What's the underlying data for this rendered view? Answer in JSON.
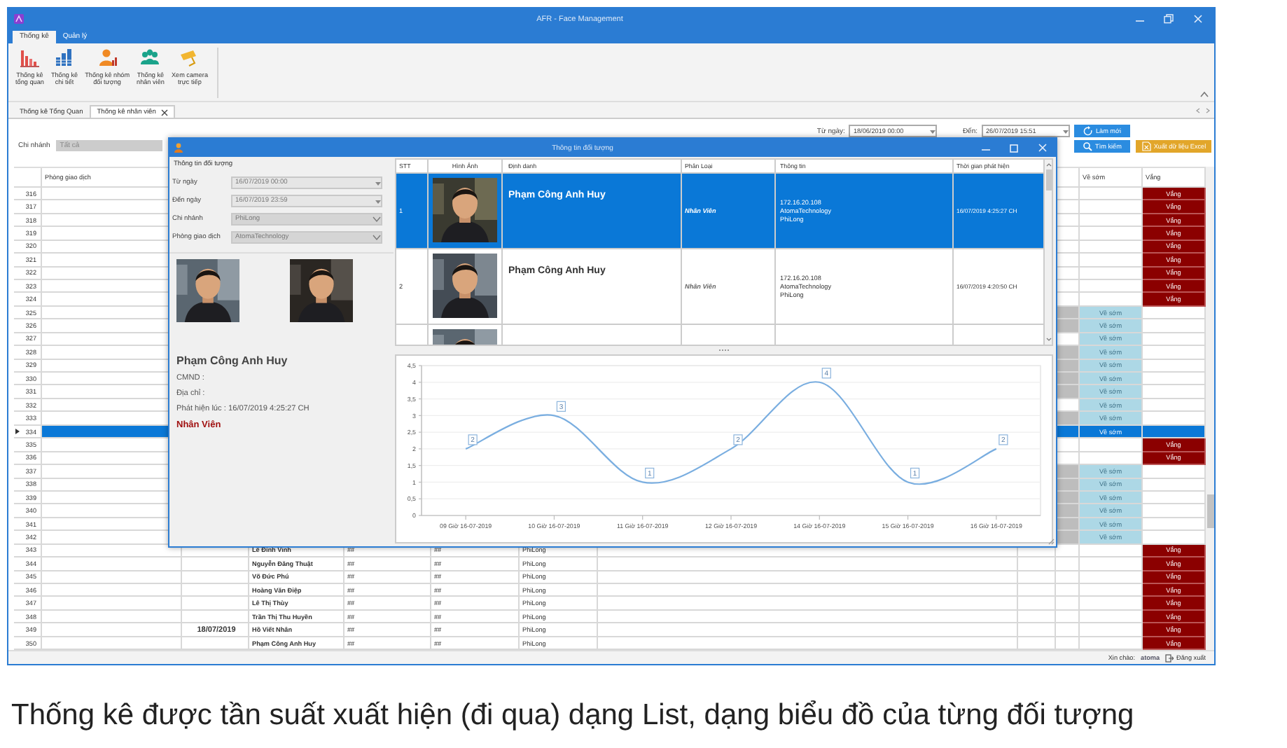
{
  "window": {
    "title": "AFR - Face Management"
  },
  "ribbon_tabs": [
    {
      "label": "Thống kê",
      "selected": true
    },
    {
      "label": "Quản lý",
      "selected": false
    }
  ],
  "ribbon_buttons": [
    {
      "kind": "overview",
      "lines": [
        "Thống kê",
        "tổng quan"
      ]
    },
    {
      "kind": "detail",
      "lines": [
        "Thống kê",
        "chi tiết"
      ]
    },
    {
      "kind": "group",
      "lines": [
        "Thống kê nhóm",
        "đối tượng"
      ]
    },
    {
      "kind": "staff",
      "lines": [
        "Thống kê",
        "nhân viên"
      ]
    },
    {
      "kind": "camera",
      "lines": [
        "Xem camera",
        "trực tiếp"
      ]
    }
  ],
  "document_tabs": [
    {
      "label": "Thống kê Tổng Quan",
      "selected": false,
      "closable": false
    },
    {
      "label": "Thống kê nhân viên",
      "selected": true,
      "closable": true
    }
  ],
  "filters": {
    "branch_label": "Chi nhánh",
    "branch_value": "Tất cả",
    "from_label": "Từ ngày:",
    "from_value": "18/06/2019 00:00",
    "to_label": "Đến:",
    "to_value": "26/07/2019 15:51"
  },
  "buttons": [
    {
      "kind": "refresh",
      "label": "Làm mới"
    },
    {
      "kind": "search",
      "label": "Tìm kiếm"
    },
    {
      "kind": "excel",
      "label": "Xuất dữ liệu Excel"
    }
  ],
  "table": {
    "columns": [
      "Phòng giao dịch",
      "Về sớm",
      "Vắng"
    ],
    "rows": [
      {
        "no": "316",
        "absence": "Vắng",
        "shaded": false,
        "selected": false
      },
      {
        "no": "317",
        "absence": "Vắng",
        "shaded": false,
        "selected": false
      },
      {
        "no": "318",
        "absence": "Vắng",
        "shaded": false,
        "selected": false
      },
      {
        "no": "319",
        "absence": "Vắng",
        "shaded": false,
        "selected": false
      },
      {
        "no": "320",
        "absence": "Vắng",
        "shaded": false,
        "selected": false
      },
      {
        "no": "321",
        "absence": "Vắng",
        "shaded": false,
        "selected": false
      },
      {
        "no": "322",
        "absence": "Vắng",
        "shaded": false,
        "selected": false
      },
      {
        "no": "323",
        "absence": "Vắng",
        "shaded": false,
        "selected": false
      },
      {
        "no": "324",
        "absence": "Vắng",
        "shaded": false,
        "selected": false
      },
      {
        "no": "325",
        "early": "Về sớm",
        "shaded": true,
        "selected": false
      },
      {
        "no": "326",
        "early": "Về sớm",
        "shaded": true,
        "selected": false
      },
      {
        "no": "327",
        "early": "Về sớm",
        "shaded": false,
        "selected": false
      },
      {
        "no": "328",
        "early": "Về sớm",
        "shaded": true,
        "selected": false
      },
      {
        "no": "329",
        "early": "Về sớm",
        "shaded": true,
        "selected": false
      },
      {
        "no": "330",
        "early": "Về sớm",
        "shaded": true,
        "selected": false
      },
      {
        "no": "331",
        "early": "Về sớm",
        "shaded": true,
        "selected": false
      },
      {
        "no": "332",
        "early": "Về sớm",
        "shaded": false,
        "selected": false
      },
      {
        "no": "333",
        "early": "Về sớm",
        "shaded": true,
        "selected": false
      },
      {
        "no": "334",
        "early": "Về sớm",
        "shaded": false,
        "selected": true
      },
      {
        "no": "335",
        "absence": "Vắng",
        "shaded": false,
        "selected": false
      },
      {
        "no": "336",
        "absence": "Vắng",
        "shaded": false,
        "selected": false
      },
      {
        "no": "337",
        "early": "Về sớm",
        "shaded": true,
        "selected": false
      },
      {
        "no": "338",
        "early": "Về sớm",
        "shaded": true,
        "selected": false
      },
      {
        "no": "339",
        "early": "Về sớm",
        "shaded": true,
        "selected": false
      },
      {
        "no": "340",
        "early": "Về sớm",
        "shaded": true,
        "selected": false
      },
      {
        "no": "341",
        "early": "Về sớm",
        "shaded": true,
        "selected": false
      },
      {
        "no": "342",
        "early": "Về sớm",
        "shaded": true,
        "selected": false
      },
      {
        "no": "343",
        "name": "Lê Đình Vinh",
        "column_5": "##",
        "column_6": "##",
        "branch": "PhiLong",
        "absence": "Vắng",
        "shaded": false,
        "selected": false
      },
      {
        "no": "344",
        "name": "Nguyễn Đăng Thuật",
        "column_5": "##",
        "column_6": "##",
        "branch": "PhiLong",
        "absence": "Vắng",
        "shaded": false,
        "selected": false
      },
      {
        "no": "345",
        "name": "Võ Đức Phú",
        "column_5": "##",
        "column_6": "##",
        "branch": "PhiLong",
        "absence": "Vắng",
        "shaded": false,
        "selected": false
      },
      {
        "no": "346",
        "name": "Hoàng Văn Điệp",
        "column_5": "##",
        "column_6": "##",
        "branch": "PhiLong",
        "absence": "Vắng",
        "shaded": false,
        "selected": false
      },
      {
        "no": "347",
        "name": "Lê Thị Thùy",
        "column_5": "##",
        "column_6": "##",
        "branch": "PhiLong",
        "absence": "Vắng",
        "shaded": false,
        "selected": false
      },
      {
        "no": "348",
        "name": "Trần Thị Thu Huyền",
        "column_5": "##",
        "column_6": "##",
        "branch": "PhiLong",
        "absence": "Vắng",
        "shaded": false,
        "selected": false
      },
      {
        "no": "349",
        "date": "18/07/2019",
        "name": "Hồ Viết Nhân",
        "column_5": "##",
        "column_6": "##",
        "branch": "PhiLong",
        "absence": "Vắng",
        "shaded": false,
        "selected": false
      },
      {
        "no": "350",
        "name": "Phạm Công Anh Huy",
        "column_5": "##",
        "column_6": "##",
        "branch": "PhiLong",
        "absence": "Vắng",
        "shaded": false,
        "selected": false
      }
    ]
  },
  "dialog": {
    "title": "Thông tin đối tượng",
    "group_title": "Thông tin đối tượng",
    "fields": [
      {
        "label": "Từ ngày",
        "value": "16/07/2019 00:00",
        "kind": "date",
        "disabled": true
      },
      {
        "label": "Đến ngày",
        "value": "16/07/2019 23:59",
        "kind": "date",
        "disabled": true
      },
      {
        "label": "Chi nhánh",
        "value": "PhiLong",
        "kind": "select",
        "disabled": true
      },
      {
        "label": "Phòng giao dịch",
        "value": "AtomaTechnology",
        "kind": "select",
        "disabled": true
      }
    ],
    "person": {
      "name": "Phạm Công Anh Huy",
      "id_line": "CMND :",
      "address_line": "Địa chỉ :",
      "detected_line": "Phát hiện lúc : 16/07/2019 4:25:27 CH",
      "category": "Nhân Viên"
    },
    "grid": {
      "columns": [
        "STT",
        "Hình Ảnh",
        "Định danh",
        "Phân Loại",
        "Thông tin",
        "Thời gian phát hiện"
      ],
      "rows": [
        {
          "stt": "1",
          "name": "Phạm Công Anh Huy",
          "category": "Nhân Viên",
          "info": [
            "172.16.20.108",
            "AtomaTechnology",
            "PhiLong"
          ],
          "time": "16/07/2019 4:25:27 CH",
          "selected": true
        },
        {
          "stt": "2",
          "name": "Phạm Công Anh Huy",
          "category": "Nhân Viên",
          "info": [
            "172.16.20.108",
            "AtomaTechnology",
            "PhiLong"
          ],
          "time": "16/07/2019 4:20:50 CH",
          "selected": false
        },
        {
          "selected": false
        }
      ]
    },
    "chart_data": {
      "type": "line",
      "categories": [
        "09 Giờ 16-07-2019",
        "10 Giờ 16-07-2019",
        "11 Giờ 16-07-2019",
        "12 Giờ 16-07-2019",
        "14 Giờ 16-07-2019",
        "15 Giờ 16-07-2019",
        "16 Giờ 16-07-2019"
      ],
      "series": [
        {
          "color": "#7aaee0",
          "values": [
            2,
            3,
            1,
            2,
            4,
            1,
            2
          ]
        }
      ],
      "ylim": [
        0,
        4.5
      ],
      "yticks": [
        {
          "value": 0,
          "label": "0"
        },
        {
          "value": 0.5,
          "label": "0,5"
        },
        {
          "value": 1,
          "label": "1"
        },
        {
          "value": 1.5,
          "label": "1,5"
        },
        {
          "value": 2,
          "label": "2"
        },
        {
          "value": 2.5,
          "label": "2,5"
        },
        {
          "value": 3,
          "label": "3"
        },
        {
          "value": 3.5,
          "label": "3,5"
        },
        {
          "value": 4,
          "label": "4"
        },
        {
          "value": 4.5,
          "label": "4,5"
        }
      ],
      "grid": true,
      "data_labels": true
    }
  },
  "status_bar": {
    "greeting": "Xin chào:",
    "user": "atoma",
    "logout": "Đăng xuất"
  },
  "caption": "Thống kê được tần suất xuất hiện (đi qua) dạng List, dạng biểu đồ của từng đối tượng"
}
